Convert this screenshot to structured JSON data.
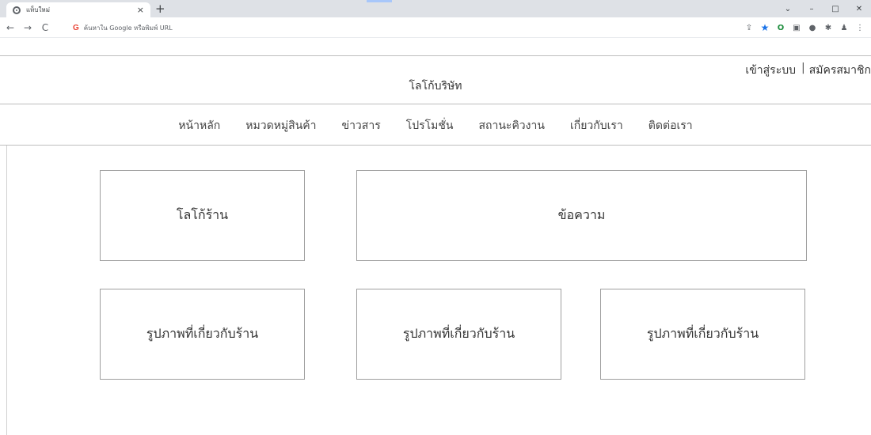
{
  "browser": {
    "tab_title": "แท็บใหม่",
    "tab_close": "×",
    "new_tab": "+",
    "window_controls": {
      "dropdown": "⌄",
      "minimize": "–",
      "maximize": "□",
      "close": "✕"
    },
    "nav": {
      "back": "←",
      "forward": "→",
      "reload": "C"
    },
    "omnibox": {
      "g_icon": "G",
      "placeholder": "ค้นหาใน Google หรือพิมพ์ URL"
    }
  },
  "header": {
    "company_logo": "โลโก้บริษัท",
    "login": "เข้าสู่ระบบ",
    "separator": "|",
    "register": "สมัครสมาชิก"
  },
  "nav_menu": [
    {
      "label": "หน้าหลัก"
    },
    {
      "label": "หมวดหมู่สินค้า"
    },
    {
      "label": "ข่าวสาร"
    },
    {
      "label": "โปรโมชั่น"
    },
    {
      "label": "สถานะคิวงาน"
    },
    {
      "label": "เกี่ยวกับเรา"
    },
    {
      "label": "ติดต่อเรา"
    }
  ],
  "content": {
    "shop_logo": "โลโก้ร้าน",
    "message": "ข้อความ",
    "images": [
      "รูปภาพที่เกี่ยวกับร้าน",
      "รูปภาพที่เกี่ยวกับร้าน",
      "รูปภาพที่เกี่ยวกับร้าน"
    ]
  }
}
